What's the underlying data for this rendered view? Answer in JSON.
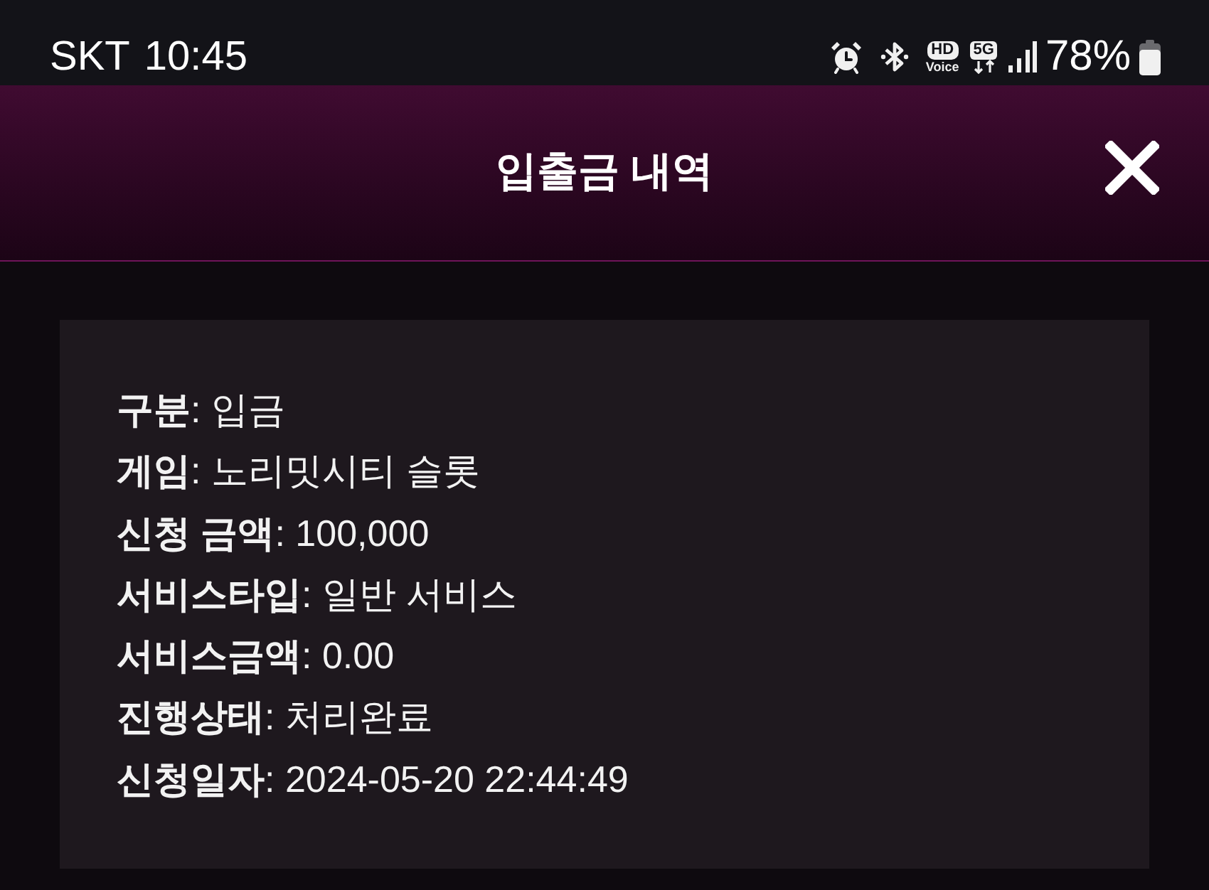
{
  "status_bar": {
    "carrier": "SKT",
    "time": "10:45",
    "hd_voice": {
      "top": "HD",
      "bottom": "Voice"
    },
    "network": "5G",
    "battery": "78%"
  },
  "header": {
    "title": "입출금 내역"
  },
  "details": [
    "**구분**: 입금",
    "**게임**: 노리밋시티 슬롯",
    "**신청 금액**: 100,000",
    "**서비스타입**: 일반 서비스",
    "**서비스금액**: 0.00",
    "**진행상태**: 처리완료",
    "**신청일자**: 2024-05-20 22:44:49"
  ]
}
